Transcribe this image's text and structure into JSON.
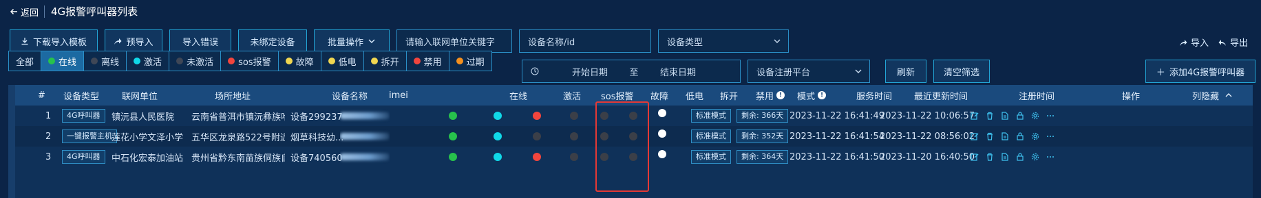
{
  "header": {
    "back_label": "返回",
    "title": "4G报警呼叫器列表"
  },
  "toolbar": {
    "download_template": "下载导入模板",
    "pre_import": "预导入",
    "import_errors": "导入错误",
    "unbound_devices": "未绑定设备",
    "batch_ops": "批量操作",
    "unit_keyword_placeholder": "请输入联网单位关键字",
    "device_name_placeholder": "设备名称/id",
    "device_type_placeholder": "设备类型",
    "import_label": "导入",
    "export_label": "导出"
  },
  "filters": {
    "items": [
      {
        "label": "全部",
        "color": ""
      },
      {
        "label": "在线",
        "color": "#27c24c"
      },
      {
        "label": "离线",
        "color": "#3f4756"
      },
      {
        "label": "激活",
        "color": "#10d8e8"
      },
      {
        "label": "未激活",
        "color": "#3f4756"
      },
      {
        "label": "sos报警",
        "color": "#f2453d"
      },
      {
        "label": "故障",
        "color": "#f0d650"
      },
      {
        "label": "低电",
        "color": "#f0d650"
      },
      {
        "label": "拆开",
        "color": "#f0d650"
      },
      {
        "label": "禁用",
        "color": "#f2453d"
      },
      {
        "label": "过期",
        "color": "#f5901e"
      }
    ],
    "active_index": 1,
    "start_date": "开始日期",
    "to": "至",
    "end_date": "结束日期",
    "platform_placeholder": "设备注册平台",
    "refresh": "刷新",
    "clear": "清空筛选",
    "add_device": "添加4G报警呼叫器"
  },
  "table": {
    "headers": {
      "index": "#",
      "type": "设备类型",
      "unit": "联网单位",
      "address": "场所地址",
      "name": "设备名称",
      "imei": "imei",
      "online": "在线",
      "active": "激活",
      "sos": "sos报警",
      "fault": "故障",
      "low": "低电",
      "open": "拆开",
      "disabled": "禁用",
      "mode": "模式",
      "service": "服务时间",
      "updated": "最近更新时间",
      "registered": "注册时间",
      "ops": "操作",
      "hide": "列隐藏"
    },
    "rows": [
      {
        "index": "1",
        "type": "4G呼叫器",
        "unit": "镇沅县人民医院",
        "address": "云南省普洱市镇沅彝族哈尼...",
        "name": "设备299237",
        "imei": "8...",
        "online": "#27c24c",
        "active": "#10d8e8",
        "sos": "#f2453d",
        "fault": "#3b3f48",
        "low": "#3b3f48",
        "open": "#3b3f48",
        "disabled": "#ffffff",
        "mode": "标准模式",
        "service": "剩余: 366天",
        "updated": "2023-11-22 16:41:49",
        "registered": "2023-11-22 10:06:57"
      },
      {
        "index": "2",
        "type": "一键报警主机",
        "unit": "莲花小学文泽小学",
        "address": "五华区龙泉路522号附近",
        "name": "烟草科技幼...",
        "imei": "",
        "online": "#27c24c",
        "active": "#10d8e8",
        "sos": "#3b3f48",
        "fault": "#3b3f48",
        "low": "#3b3f48",
        "open": "#3b3f48",
        "disabled": "#ffffff",
        "mode": "标准模式",
        "service": "剩余: 352天",
        "updated": "2023-11-22 16:41:54",
        "registered": "2023-11-22 08:56:02"
      },
      {
        "index": "3",
        "type": "4G呼叫器",
        "unit": "中石化宏泰加油站",
        "address": "贵州省黔东南苗族侗族自治...",
        "name": "设备740560",
        "imei": "",
        "online": "#27c24c",
        "active": "#10d8e8",
        "sos": "#f2453d",
        "fault": "#3b3f48",
        "low": "#3b3f48",
        "open": "#3b3f48",
        "disabled": "#ffffff",
        "mode": "标准模式",
        "service": "剩余: 364天",
        "updated": "2023-11-22 16:41:50",
        "registered": "2023-11-20 16:40:50"
      }
    ]
  }
}
